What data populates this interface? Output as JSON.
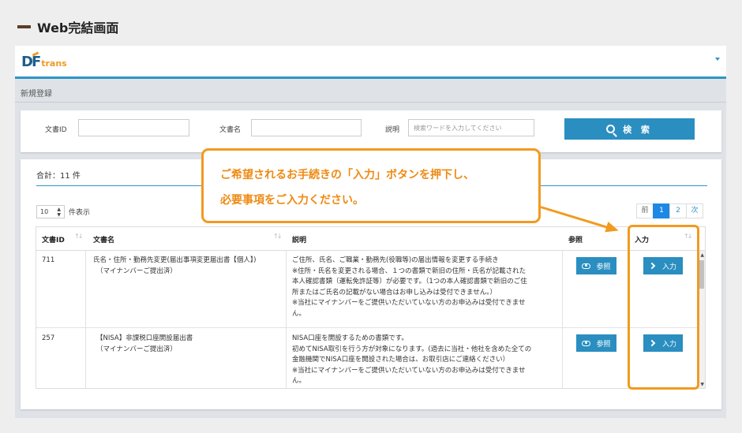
{
  "page_heading": "Web完結画面",
  "app": {
    "logo": {
      "d": "D",
      "f": "F",
      "trans": "trans"
    },
    "breadcrumb": "新規登録"
  },
  "search": {
    "doc_id_label": "文書ID",
    "doc_id_value": "",
    "doc_name_label": "文書名",
    "doc_name_value": "",
    "desc_label": "説明",
    "desc_placeholder": "検索ワードを入力してください",
    "button_label": "検 索"
  },
  "list": {
    "total_label": "合計：11 件",
    "per_page_value": "10",
    "per_page_suffix": "件表示",
    "pager": {
      "prev": "前",
      "pages": [
        "1",
        "2"
      ],
      "next": "次",
      "current": "1"
    },
    "columns": {
      "id": "文書ID",
      "name": "文書名",
      "desc": "説明",
      "ref": "参照",
      "input": "入力"
    },
    "rows": [
      {
        "id": "711",
        "name_lines": [
          "氏名・住所・勤務先変更(届出事項変更届出書【個人】)",
          "（マイナンバーご提出済）"
        ],
        "desc_lines": [
          "ご住所、氏名、ご職業・勤務先(役職等)の届出情報を変更する手続き",
          "※住所・氏名を変更される場合、１つの書類で新旧の住所・氏名が記載された",
          "本人確認書類（運転免許証等）が必要です。（1つの本人確認書類で新旧のご住",
          "所またはご氏名の記載がない場合はお申し込みは受付できません。）",
          "※当社にマイナンバーをご提供いただいていない方のお申込みは受付できませ",
          "ん。"
        ],
        "ref_label": "参照",
        "input_label": "入力"
      },
      {
        "id": "257",
        "name_lines": [
          "【NISA】非課税口座開設届出書",
          "（マイナンバーご提出済）"
        ],
        "desc_lines": [
          "NISA口座を開設するための書類です。",
          "初めてNISA取引を行う方が対象になります。(過去に当社・他社を含めた全ての",
          "金融機関でNISA口座を開設された場合は、お取引店にご連絡ください）",
          "※当社にマイナンバーをご提供いただいていない方のお申込みは受付できませ",
          "ん。"
        ],
        "ref_label": "参照",
        "input_label": "入力"
      }
    ]
  },
  "callout": {
    "line1": "ご希望されるお手続きの「入力」ボタンを押下し、",
    "line2": "必要事項をご入力ください。"
  },
  "colors": {
    "accent": "#2a8ec0",
    "callout": "#f29a1f",
    "heading_bar": "#5a3e2b"
  }
}
